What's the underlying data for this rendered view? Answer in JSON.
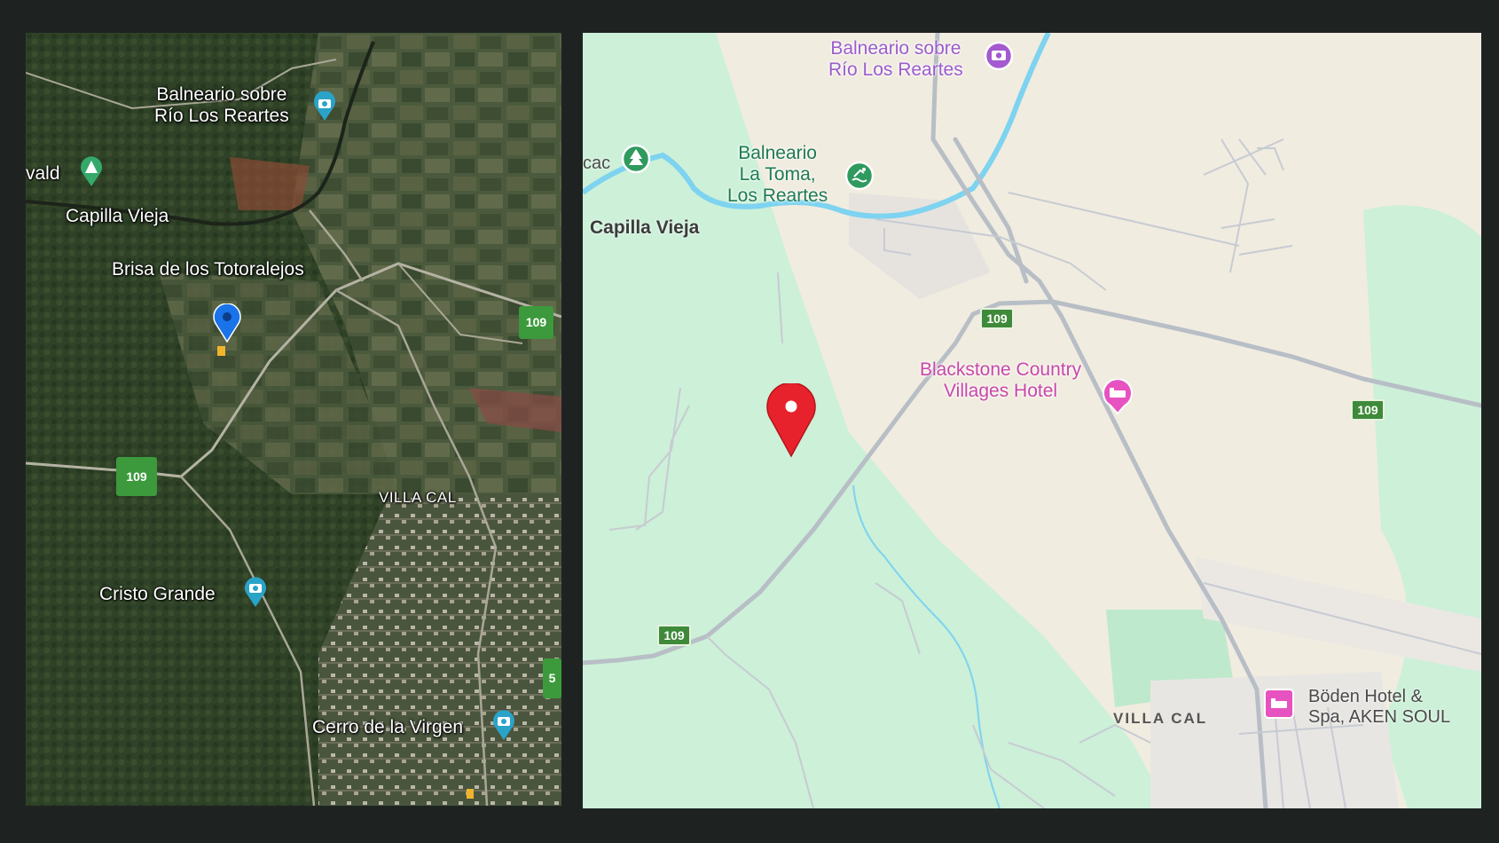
{
  "satellite": {
    "labels": {
      "balneario_rio": "Balneario sobre\nRío Los Reartes",
      "vald": "vald",
      "capilla": "Capilla Vieja",
      "brisa": "Brisa de los Totoralejos",
      "villa_cal": "VILLA CAL",
      "cristo": "Cristo Grande",
      "cerro": "Cerro de la Virgen"
    },
    "route_shields": [
      "109",
      "109",
      "5"
    ]
  },
  "roadmap": {
    "labels": {
      "balneario_rio": "Balneario sobre\nRío Los Reartes",
      "cac": "cac",
      "balneario_toma": "Balneario\nLa Toma,\nLos Reartes",
      "capilla": "Capilla Vieja",
      "blackstone": "Blackstone Country\nVillages Hotel",
      "villa_cal": "VILLA CAL",
      "boden": "Böden Hotel &\nSpa, AKEN SOUL"
    },
    "route_shields": [
      "109",
      "109",
      "109"
    ]
  },
  "colors": {
    "background": "#1e2322",
    "map_land": "#f1ece0",
    "map_green": "#ccf0d8",
    "water": "#7dd3f0",
    "selected_pin": "#e8222c",
    "satellite_pin": "#1a73e8"
  },
  "icons": [
    "camera-icon",
    "tree-icon",
    "tent-icon",
    "swimming-icon",
    "hotel-icon",
    "map-pin-icon"
  ]
}
